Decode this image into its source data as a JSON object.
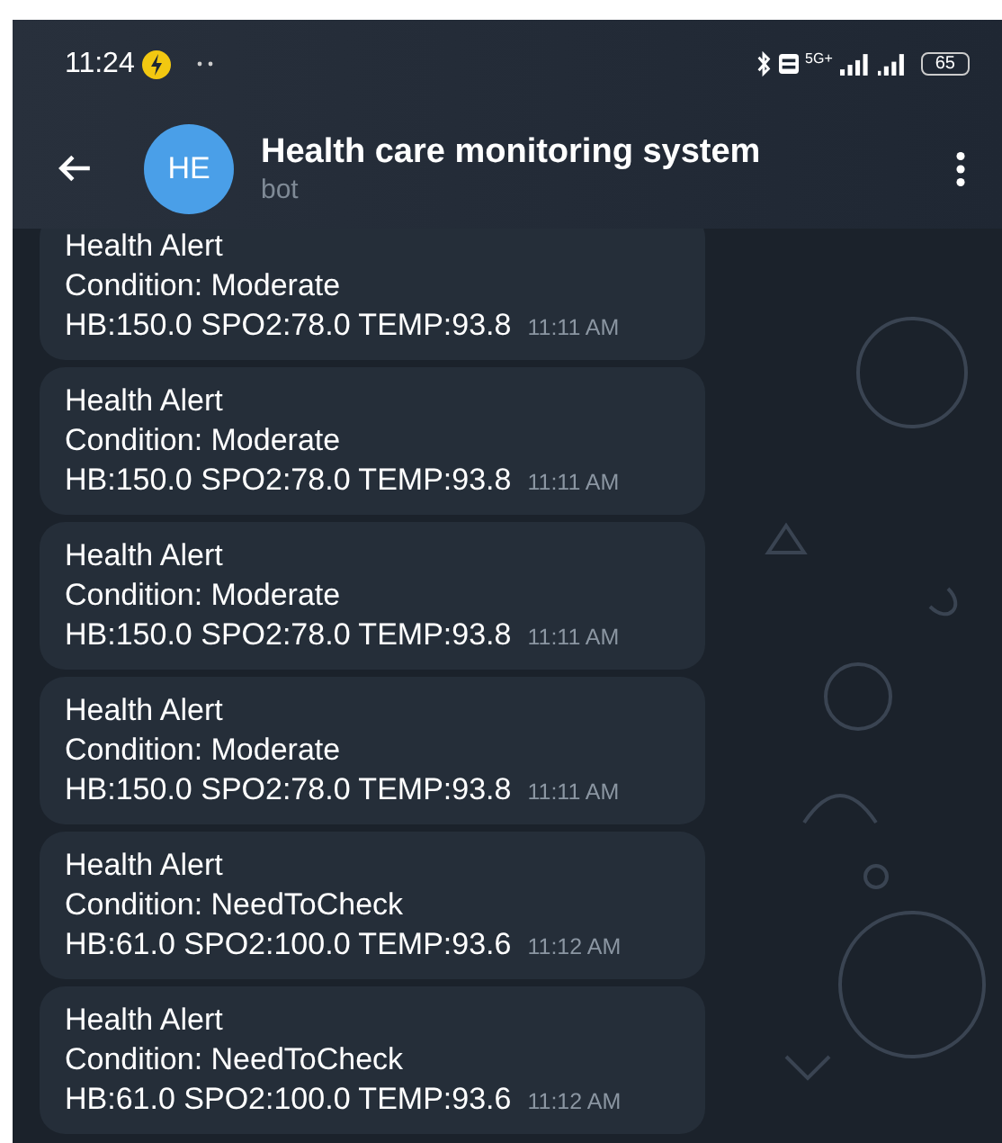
{
  "status_bar": {
    "time": "11:24",
    "network": "5G+",
    "battery": "65"
  },
  "header": {
    "avatar": "HE",
    "title": "Health care monitoring system",
    "subtitle": "bot"
  },
  "messages": [
    {
      "lines": [
        "Health Alert",
        "Condition: Moderate",
        "HB:150.0 SPO2:78.0 TEMP:93.8"
      ],
      "time": "11:11 AM"
    },
    {
      "lines": [
        "Health Alert",
        "Condition: Moderate",
        "HB:150.0 SPO2:78.0 TEMP:93.8"
      ],
      "time": "11:11 AM"
    },
    {
      "lines": [
        "Health Alert",
        "Condition: Moderate",
        "HB:150.0 SPO2:78.0 TEMP:93.8"
      ],
      "time": "11:11 AM"
    },
    {
      "lines": [
        "Health Alert",
        "Condition: Moderate",
        "HB:150.0 SPO2:78.0 TEMP:93.8"
      ],
      "time": "11:11 AM"
    },
    {
      "lines": [
        "Health Alert",
        "Condition: NeedToCheck",
        "HB:61.0 SPO2:100.0 TEMP:93.6"
      ],
      "time": "11:12 AM"
    },
    {
      "lines": [
        "Health Alert",
        "Condition: NeedToCheck",
        "HB:61.0 SPO2:100.0 TEMP:93.6"
      ],
      "time": "11:12 AM"
    }
  ]
}
